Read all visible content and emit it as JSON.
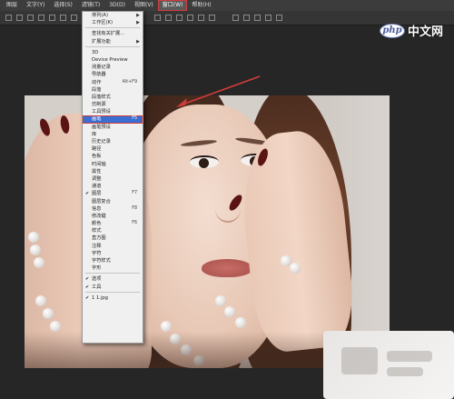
{
  "menubar": {
    "items": [
      {
        "label": "图层"
      },
      {
        "label": "文字(Y)"
      },
      {
        "label": "选择(S)"
      },
      {
        "label": "滤镜(T)"
      },
      {
        "label": "3D(D)"
      },
      {
        "label": "视图(V)"
      },
      {
        "label": "窗口(W)"
      },
      {
        "label": "帮助(H)"
      }
    ],
    "active_index": 6
  },
  "window_menu": {
    "items": [
      {
        "label": "排列(A)",
        "submenu": true
      },
      {
        "label": "工作区(K)",
        "submenu": true
      },
      {
        "sep": true
      },
      {
        "label": "查找有关扩展..."
      },
      {
        "label": "扩展功能",
        "submenu": true
      },
      {
        "sep": true
      },
      {
        "label": "3D"
      },
      {
        "label": "Device Preview"
      },
      {
        "label": "测量记录"
      },
      {
        "label": "导航器"
      },
      {
        "label": "动作",
        "shortcut": "Alt+F9"
      },
      {
        "label": "段落"
      },
      {
        "label": "段落样式"
      },
      {
        "label": "仿制源"
      },
      {
        "label": "工具预设"
      },
      {
        "label": "画笔",
        "shortcut": "F5",
        "highlighted": true
      },
      {
        "label": "画笔预设"
      },
      {
        "label": "库"
      },
      {
        "label": "历史记录"
      },
      {
        "label": "路径"
      },
      {
        "label": "色板"
      },
      {
        "label": "时间轴"
      },
      {
        "label": "属性"
      },
      {
        "label": "调整"
      },
      {
        "label": "通道"
      },
      {
        "label": "图层",
        "shortcut": "F7",
        "checked": true
      },
      {
        "label": "图层复合"
      },
      {
        "label": "信息",
        "shortcut": "F8"
      },
      {
        "label": "修改键"
      },
      {
        "label": "颜色",
        "shortcut": "F6"
      },
      {
        "label": "样式"
      },
      {
        "label": "直方图"
      },
      {
        "label": "注释"
      },
      {
        "label": "字符"
      },
      {
        "label": "字符样式"
      },
      {
        "label": "字形"
      },
      {
        "sep": true
      },
      {
        "label": "选项",
        "checked": true
      },
      {
        "label": "工具",
        "checked": true
      },
      {
        "sep": true
      },
      {
        "label": "1 1.jpg",
        "checked": true
      }
    ]
  },
  "watermark": {
    "badge": "php",
    "text": "中文网"
  },
  "colors": {
    "menubar_bg": "#3c3c3c",
    "workspace_bg": "#262626",
    "highlight": "#3a6fd1",
    "annotation": "#d23b3b"
  }
}
